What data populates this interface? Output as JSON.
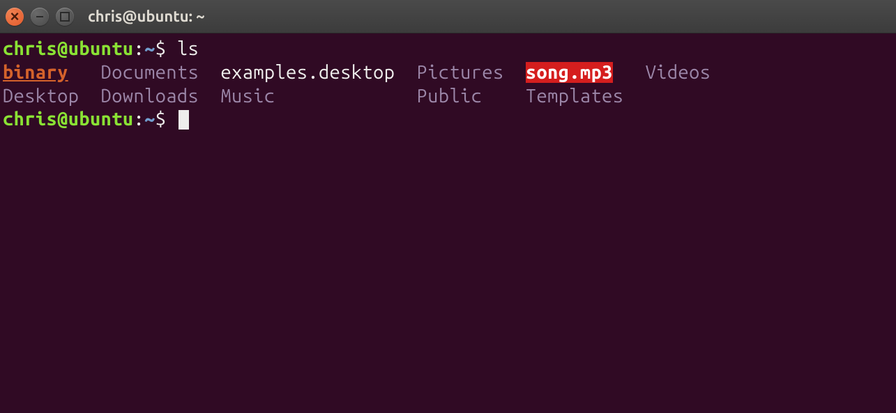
{
  "window": {
    "title": "chris@ubuntu: ~"
  },
  "prompt": {
    "user_host": "chris@ubuntu",
    "colon": ":",
    "path": "~",
    "dollar": "$"
  },
  "command1": "ls",
  "ls": {
    "row1": {
      "col1": "binary",
      "col2": "Documents",
      "col3": "examples.desktop",
      "col4": "Pictures",
      "col5": "song.mp3",
      "col6": "Videos"
    },
    "row2": {
      "col1": "Desktop",
      "col2": "Downloads",
      "col3": "Music",
      "col4": "Public",
      "col5": "Templates"
    }
  }
}
